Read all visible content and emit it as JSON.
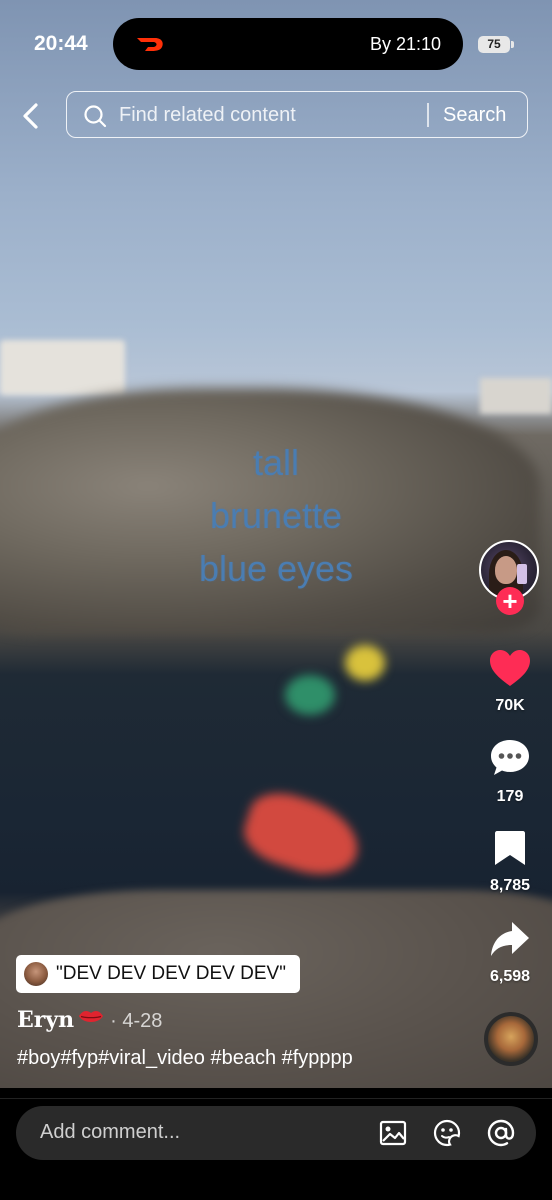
{
  "status_bar": {
    "time": "20:44",
    "live_activity_text": "By 21:10",
    "battery_level": "75"
  },
  "search": {
    "placeholder": "Find related content",
    "button_label": "Search"
  },
  "video": {
    "overlay_lines": [
      "tall",
      "brunette",
      "blue eyes"
    ]
  },
  "actions": {
    "likes": "70K",
    "comments": "179",
    "saves": "8,785",
    "shares": "6,598"
  },
  "caption": {
    "sound_label": "\"DEV DEV DEV DEV DEV\"",
    "username": "Eryn",
    "date": "· 4-28",
    "hashtags": "#boy#fyp#viral_video #beach #fypppp"
  },
  "comment_bar": {
    "placeholder": "Add comment..."
  },
  "colors": {
    "like_red": "#fe2c55",
    "overlay_text_blue": "#4a7db2",
    "doordash_red": "#ff3008"
  }
}
